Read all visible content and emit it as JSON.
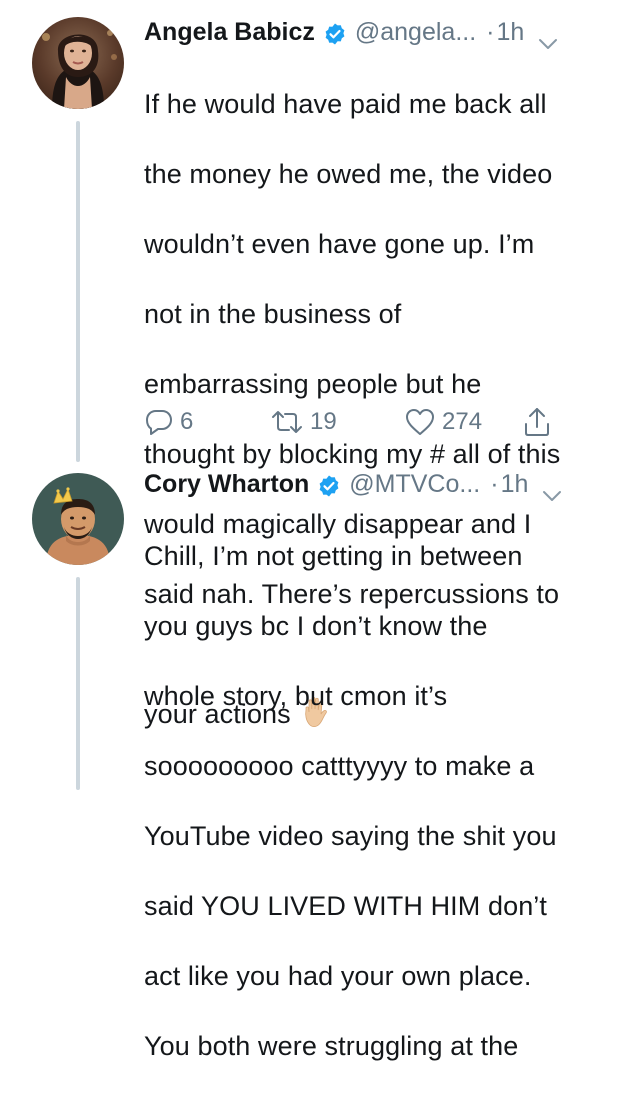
{
  "tweets": [
    {
      "name": "Angela Babicz",
      "handle": "@angela...",
      "separator": "·",
      "time": "1h",
      "lines": [
        "If he would have paid me back all",
        "the money he owed me, the video",
        "wouldn’t even have gone up. I’m",
        "not in the business of",
        "embarrassing people but he",
        "thought by blocking my # all of this",
        "would magically disappear and I",
        "said nah. There’s repercussions to",
        "your actions"
      ],
      "emoji": "raised-hand-emoji",
      "replies": "6",
      "retweets": "19",
      "likes": "274"
    },
    {
      "name": "Cory Wharton",
      "handle": "@MTVCo...",
      "separator": "·",
      "time": "1h",
      "lines": [
        "Chill, I’m not getting in between",
        "you guys bc I don’t know the",
        "whole story, but cmon it’s",
        "sooooooooo catttyyyy to make a",
        "YouTube video saying the shit you",
        "said YOU LIVED WITH HIM don’t",
        "act like you had your own place.",
        "You both were struggling at the"
      ]
    }
  ],
  "colors": {
    "text": "#14171a",
    "secondary": "#657786",
    "verified": "#1da1f2",
    "thread_line": "#ccd6dd"
  },
  "icons": [
    "verified-icon",
    "chevron-down-icon",
    "reply-icon",
    "retweet-icon",
    "like-icon",
    "share-icon"
  ]
}
